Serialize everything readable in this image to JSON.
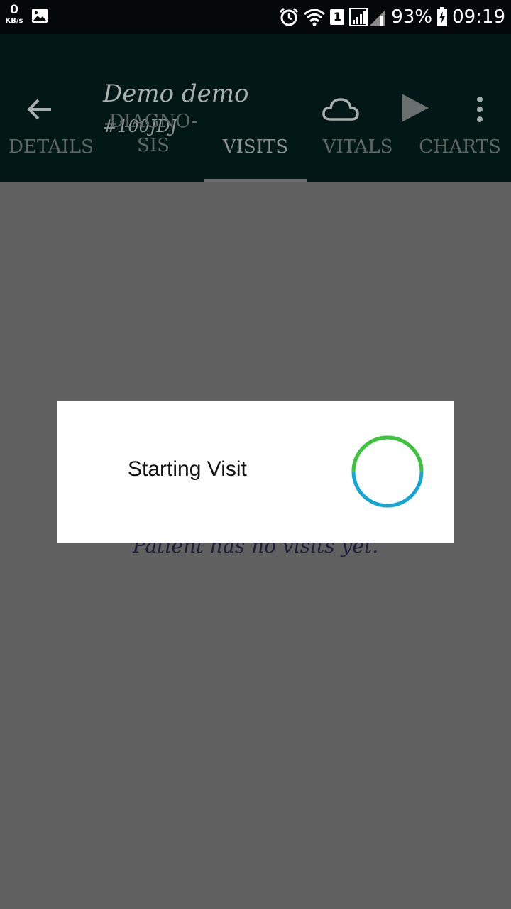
{
  "status_bar": {
    "speed_value": "0",
    "speed_unit": "KB/s",
    "image_icon": "image-icon",
    "alarm_icon": "alarm-icon",
    "wifi_icon": "wifi-icon",
    "sim_label": "1",
    "signal_icon": "signal-icon",
    "battery_percent": "93%",
    "battery_icon": "battery-charging-icon",
    "time": "09:19"
  },
  "toolbar": {
    "back_icon": "arrow-back-icon",
    "title": "Demo demo",
    "subtitle": "#100JDJ",
    "cloud_icon": "cloud-icon",
    "play_icon": "play-icon",
    "more_icon": "more-vert-icon"
  },
  "tabs": [
    {
      "label": "DETAILS",
      "active": false
    },
    {
      "label_line1": "DIAGNO-",
      "label_line2": "SIS",
      "active": false
    },
    {
      "label": "VISITS",
      "active": true
    },
    {
      "label": "VITALS",
      "active": false
    },
    {
      "label": "CHARTS",
      "active": false
    }
  ],
  "content": {
    "empty_message": "Patient has no visits yet."
  },
  "dialog": {
    "message": "Starting Visit",
    "spinner_colors": [
      "#3ec43a",
      "#15a7d3"
    ]
  },
  "colors": {
    "app_bar": "#021817",
    "status_bar": "#050808",
    "scrim_background": "#616161"
  }
}
